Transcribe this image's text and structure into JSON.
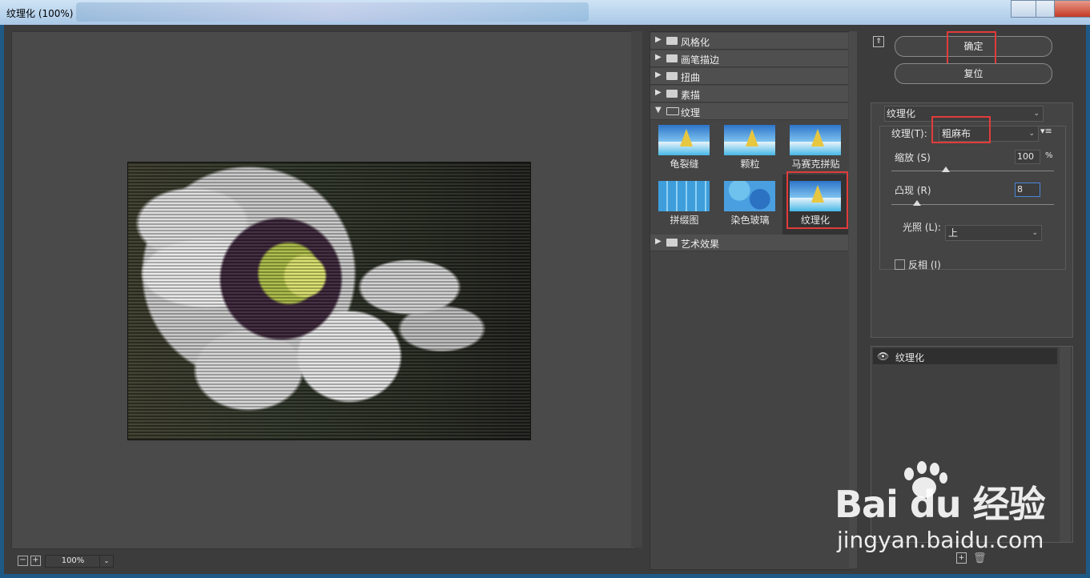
{
  "window": {
    "title": "纹理化 (100%)"
  },
  "zoom": {
    "minus": "−",
    "plus": "+",
    "value": "100%",
    "dropdown": "⌄"
  },
  "gallery": {
    "categories": [
      {
        "label": "风格化"
      },
      {
        "label": "画笔描边"
      },
      {
        "label": "扭曲"
      },
      {
        "label": "素描"
      },
      {
        "label": "纹理"
      },
      {
        "label": "艺术效果"
      }
    ],
    "thumbs": [
      {
        "label": "龟裂缝"
      },
      {
        "label": "颗粒"
      },
      {
        "label": "马赛克拼贴"
      },
      {
        "label": "拼缀图"
      },
      {
        "label": "染色玻璃"
      },
      {
        "label": "纹理化"
      }
    ]
  },
  "actions": {
    "ok": "确定",
    "reset": "复位"
  },
  "filter": {
    "selected": "纹理化",
    "texture_label": "纹理",
    "texture_key": "(T)",
    "texture_value": "粗麻布",
    "scale_label": "缩放",
    "scale_key": "(S)",
    "scale_value": "100",
    "scale_unit": "%",
    "relief_label": "凸现",
    "relief_key": "(R)",
    "relief_value": "8",
    "light_label": "光照",
    "light_key": "(L)",
    "light_value": "上",
    "invert_label": "反相",
    "invert_key": "(I)",
    "invert_checked": false
  },
  "layers": [
    {
      "name": "纹理化"
    }
  ],
  "watermark": {
    "brand": "Bai du 经验",
    "url": "jingyan.baidu.com"
  },
  "colors": {
    "highlight": "#e23b3b",
    "panel": "#444444"
  }
}
